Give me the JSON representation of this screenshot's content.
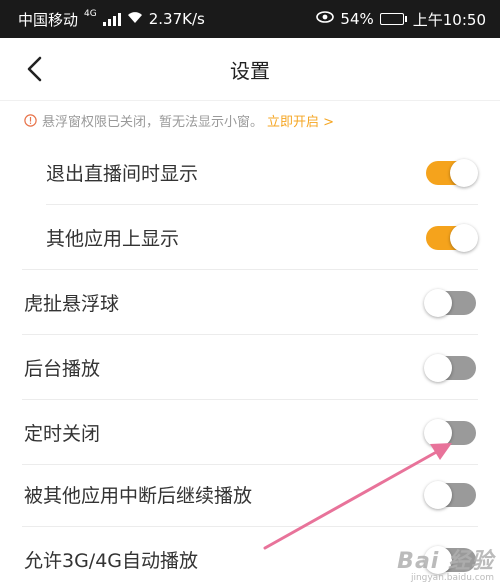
{
  "status_bar": {
    "carrier": "中国移动",
    "network_badge": "4G",
    "speed": "2.37K/s",
    "battery_percent": "54%",
    "battery_level": 0.54,
    "time": "上午10:50",
    "icons": [
      "signal-icon",
      "wifi-icon",
      "eye-icon",
      "battery-icon"
    ]
  },
  "nav": {
    "title": "设置",
    "back_icon": "chevron-left-icon"
  },
  "notice": {
    "text": "悬浮窗权限已关闭，暂无法显示小窗。",
    "link": "立即开启 >",
    "icon": "info-circle-icon"
  },
  "settings": [
    {
      "label": "退出直播间时显示",
      "on": true,
      "indent": true
    },
    {
      "label": "其他应用上显示",
      "on": true,
      "indent": true
    },
    {
      "label": "虎扯悬浮球",
      "on": false,
      "indent": false
    },
    {
      "label": "后台播放",
      "on": false,
      "indent": false
    },
    {
      "label": "定时关闭",
      "on": false,
      "indent": false
    },
    {
      "label": "被其他应用中断后继续播放",
      "on": false,
      "indent": false
    },
    {
      "label": "允许3G/4G自动播放",
      "on": false,
      "indent": false
    }
  ],
  "watermark": {
    "main": "Bai 经验",
    "sub": "jingyan.baidu.com"
  },
  "colors": {
    "accent": "#f5a31c",
    "toggle_off": "#9a9a9a",
    "arrow": "#e8739a",
    "status_bar_bg": "#1a1a1a"
  }
}
